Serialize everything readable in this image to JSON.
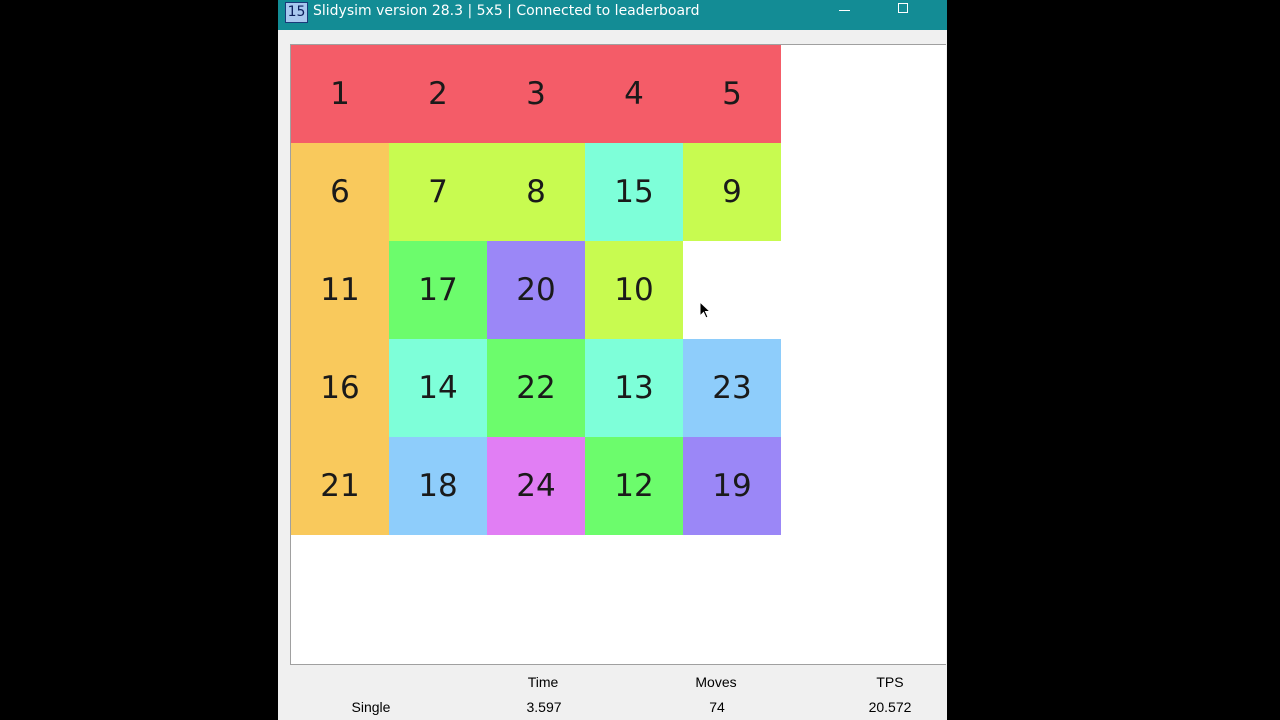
{
  "window": {
    "icon_label": "15",
    "title": "Slidysim version 28.3 | 5x5 | Connected to leaderboard"
  },
  "colors": {
    "titlebar": "#138c95",
    "row_red": "#f45c68",
    "orange": "#f9c95c",
    "lime": "#c8fb50",
    "aqua": "#7effd9",
    "green": "#6cfc6c",
    "purple": "#9b87f7",
    "sky": "#8ecdfb",
    "pink": "#e17ef4"
  },
  "board": {
    "size": 5,
    "tiles": [
      {
        "label": "1",
        "color": "#f45c68"
      },
      {
        "label": "2",
        "color": "#f45c68"
      },
      {
        "label": "3",
        "color": "#f45c68"
      },
      {
        "label": "4",
        "color": "#f45c68"
      },
      {
        "label": "5",
        "color": "#f45c68"
      },
      {
        "label": "6",
        "color": "#f9c95c"
      },
      {
        "label": "7",
        "color": "#c8fb50"
      },
      {
        "label": "8",
        "color": "#c8fb50"
      },
      {
        "label": "15",
        "color": "#7effd9"
      },
      {
        "label": "9",
        "color": "#c8fb50"
      },
      {
        "label": "11",
        "color": "#f9c95c"
      },
      {
        "label": "17",
        "color": "#6cfc6c"
      },
      {
        "label": "20",
        "color": "#9b87f7"
      },
      {
        "label": "10",
        "color": "#c8fb50"
      },
      {
        "label": "",
        "color": "#ffffff",
        "empty": true
      },
      {
        "label": "16",
        "color": "#f9c95c"
      },
      {
        "label": "14",
        "color": "#7effd9"
      },
      {
        "label": "22",
        "color": "#6cfc6c"
      },
      {
        "label": "13",
        "color": "#7effd9"
      },
      {
        "label": "23",
        "color": "#8ecdfb"
      },
      {
        "label": "21",
        "color": "#f9c95c"
      },
      {
        "label": "18",
        "color": "#8ecdfb"
      },
      {
        "label": "24",
        "color": "#e17ef4"
      },
      {
        "label": "12",
        "color": "#6cfc6c"
      },
      {
        "label": "19",
        "color": "#9b87f7"
      }
    ]
  },
  "stats": {
    "mode": "Single",
    "time_header": "Time",
    "time_value": "3.597",
    "moves_header": "Moves",
    "moves_value": "74",
    "tps_header": "TPS",
    "tps_value": "20.572"
  }
}
